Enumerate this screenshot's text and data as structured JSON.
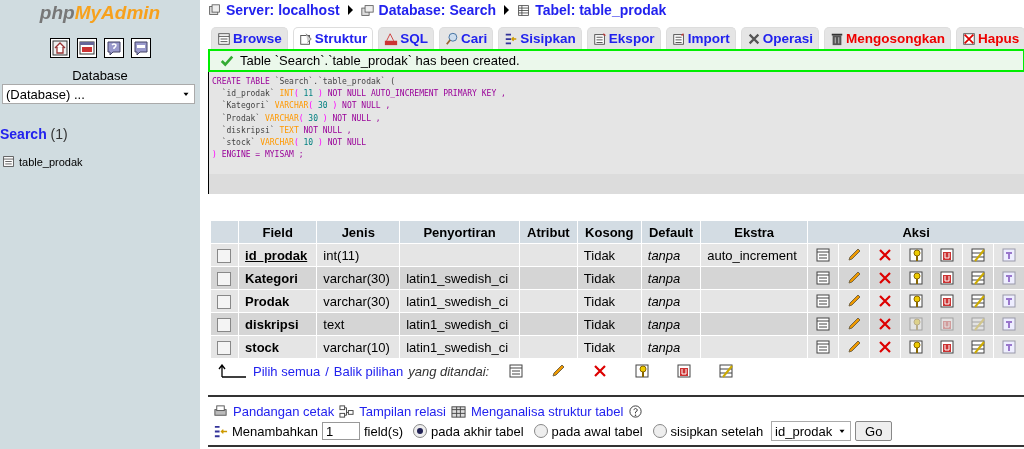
{
  "sidebar": {
    "logo": {
      "prefix": "php",
      "name": "MyAdmin"
    },
    "database_label": "Database",
    "database_select": "(Database) ...",
    "db_link": "Search",
    "db_count": "(1)",
    "tables": [
      "table_prodak"
    ]
  },
  "breadcrumb": [
    {
      "label": "Server: localhost",
      "kind": "server"
    },
    {
      "label": "Database: Search",
      "kind": "database"
    },
    {
      "label": "Tabel: table_prodak",
      "kind": "table"
    }
  ],
  "tabs": [
    {
      "label": "Browse",
      "kind": "browse",
      "danger": false,
      "selected": false
    },
    {
      "label": "Struktur",
      "kind": "structure",
      "danger": false,
      "selected": true
    },
    {
      "label": "SQL",
      "kind": "sql",
      "danger": false,
      "selected": false
    },
    {
      "label": "Cari",
      "kind": "search",
      "danger": false,
      "selected": false
    },
    {
      "label": "Sisipkan",
      "kind": "insert",
      "danger": false,
      "selected": false
    },
    {
      "label": "Ekspor",
      "kind": "export",
      "danger": false,
      "selected": false
    },
    {
      "label": "Import",
      "kind": "import",
      "danger": false,
      "selected": false
    },
    {
      "label": "Operasi",
      "kind": "tools",
      "danger": false,
      "selected": false
    },
    {
      "label": "Mengosongkan",
      "kind": "empty",
      "danger": true,
      "selected": false
    },
    {
      "label": "Hapus",
      "kind": "drop",
      "danger": true,
      "selected": false
    }
  ],
  "message": "Table `Search`.`table_prodak` has been created.",
  "sql": [
    {
      "segments": [
        {
          "text": "CREATE TABLE ",
          "kind": "keyword"
        },
        {
          "text": "`Search`.`table_prodak` (",
          "kind": "identifier"
        }
      ]
    },
    {
      "segments": [
        {
          "text": "  `id_prodak` ",
          "kind": "identifier"
        },
        {
          "text": "INT",
          "kind": "type"
        },
        {
          "text": "( ",
          "kind": "punct"
        },
        {
          "text": "11",
          "kind": "number"
        },
        {
          "text": " ) ",
          "kind": "punct"
        },
        {
          "text": "NOT NULL AUTO_INCREMENT PRIMARY KEY ,",
          "kind": "keyword"
        }
      ]
    },
    {
      "segments": [
        {
          "text": "  `Kategori` ",
          "kind": "identifier"
        },
        {
          "text": "VARCHAR",
          "kind": "type"
        },
        {
          "text": "( ",
          "kind": "punct"
        },
        {
          "text": "30",
          "kind": "number"
        },
        {
          "text": " ) ",
          "kind": "punct"
        },
        {
          "text": "NOT NULL ,",
          "kind": "keyword"
        }
      ]
    },
    {
      "segments": [
        {
          "text": "  `Prodak` ",
          "kind": "identifier"
        },
        {
          "text": "VARCHAR",
          "kind": "type"
        },
        {
          "text": "( ",
          "kind": "punct"
        },
        {
          "text": "30",
          "kind": "number"
        },
        {
          "text": " ) ",
          "kind": "punct"
        },
        {
          "text": "NOT NULL ,",
          "kind": "keyword"
        }
      ]
    },
    {
      "segments": [
        {
          "text": "  `diskripsi` ",
          "kind": "identifier"
        },
        {
          "text": "TEXT",
          "kind": "type"
        },
        {
          "text": " NOT NULL ,",
          "kind": "keyword"
        }
      ]
    },
    {
      "segments": [
        {
          "text": "  `stock` ",
          "kind": "identifier"
        },
        {
          "text": "VARCHAR",
          "kind": "type"
        },
        {
          "text": "( ",
          "kind": "punct"
        },
        {
          "text": "10",
          "kind": "number"
        },
        {
          "text": " ) ",
          "kind": "punct"
        },
        {
          "text": "NOT NULL",
          "kind": "keyword"
        }
      ]
    },
    {
      "segments": [
        {
          "text": ") ",
          "kind": "punct"
        },
        {
          "text": "ENGINE = MYISAM ;",
          "kind": "keyword"
        }
      ]
    }
  ],
  "table": {
    "columns": [
      "Field",
      "Jenis",
      "Penyortiran",
      "Atribut",
      "Kosong",
      "Default",
      "Ekstra",
      "Aksi"
    ],
    "rows": [
      {
        "checked": false,
        "field": "id_prodak",
        "primary": true,
        "type": "int(11)",
        "collation": "",
        "null": "Tidak",
        "default": "tanpa",
        "extra": "auto_increment",
        "indexable": true
      },
      {
        "checked": false,
        "field": "Kategori",
        "primary": false,
        "type": "varchar(30)",
        "collation": "latin1_swedish_ci",
        "null": "Tidak",
        "default": "tanpa",
        "extra": "",
        "indexable": true
      },
      {
        "checked": false,
        "field": "Prodak",
        "primary": false,
        "type": "varchar(30)",
        "collation": "latin1_swedish_ci",
        "null": "Tidak",
        "default": "tanpa",
        "extra": "",
        "indexable": true
      },
      {
        "checked": false,
        "field": "diskripsi",
        "primary": false,
        "type": "text",
        "collation": "latin1_swedish_ci",
        "null": "Tidak",
        "default": "tanpa",
        "extra": "",
        "indexable": false
      },
      {
        "checked": false,
        "field": "stock",
        "primary": false,
        "type": "varchar(10)",
        "collation": "latin1_swedish_ci",
        "null": "Tidak",
        "default": "tanpa",
        "extra": "",
        "indexable": true
      }
    ]
  },
  "bulk": {
    "select_all": "Pilih semua",
    "separator": "/",
    "invert": "Balik pilihan",
    "suffix": "yang ditandai:"
  },
  "links": [
    {
      "label": "Pandangan cetak",
      "kind": "print"
    },
    {
      "label": "Tampilan relasi",
      "kind": "relation"
    },
    {
      "label": "Menganalisa struktur tabel",
      "kind": "analyze"
    }
  ],
  "add_fields": {
    "label": "Menambahkan",
    "count": "1",
    "unit": "field(s)",
    "positions": [
      {
        "label": "pada akhir tabel",
        "selected": true
      },
      {
        "label": "pada awal tabel",
        "selected": false
      },
      {
        "label": "sisipkan setelah",
        "selected": false
      }
    ],
    "after_field": "id_prodak",
    "go": "Go"
  }
}
